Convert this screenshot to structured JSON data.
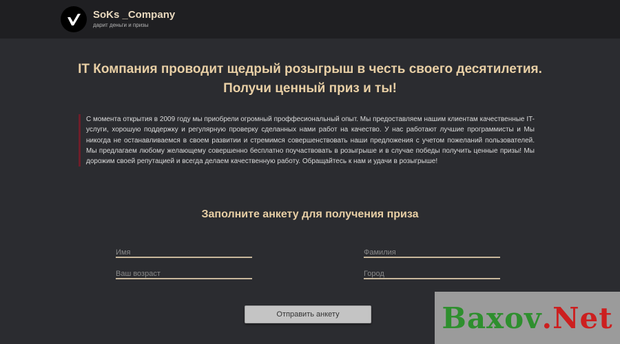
{
  "header": {
    "brand_name": "SoKs _Company",
    "tagline": "дарит деньги и призы",
    "logo_icon": "checkmark-logo-icon"
  },
  "headline": {
    "line1": "IT Компания проводит щедрый розыгрыш в честь своего десятилетия.",
    "line2": "Получи ценный приз и ты!"
  },
  "intro": {
    "text": "С момента открытия в 2009 году мы приобрели огромный проффесиональный опыт. Мы предоставляем нашим клиентам качественные IT-услуги, хорошую поддержку и регулярную проверку сделанных нами работ на качество. У нас работают лучшие программисты и Мы никогда не останавливаемся в своем развитии и стремимся совершенствовать наши предложения с учетом пожеланий пользователей. Мы предлагаем любому желающему совершенно бесплатно поучаствовать в розыгрыше и в случае победы получить ценные призы! Мы дорожим своей репутацией и всегда делаем качественную работу. Обращайтесь к нам и удачи в розыгрыше!"
  },
  "form": {
    "title": "Заполните анкету для получения приза",
    "fields": {
      "name": {
        "placeholder": "Имя",
        "value": ""
      },
      "surname": {
        "placeholder": "Фамилия",
        "value": ""
      },
      "age": {
        "placeholder": "Ваш возраст",
        "value": ""
      },
      "city": {
        "placeholder": "Город",
        "value": ""
      }
    },
    "submit_label": "Отправить анкету"
  },
  "watermark": {
    "part1": "Baxov",
    "part2": ".Net"
  },
  "colors": {
    "background": "#2b2c30",
    "header": "#1f1f22",
    "accent_text": "#e8cfa5",
    "quote_bar": "#6e1e2a"
  }
}
